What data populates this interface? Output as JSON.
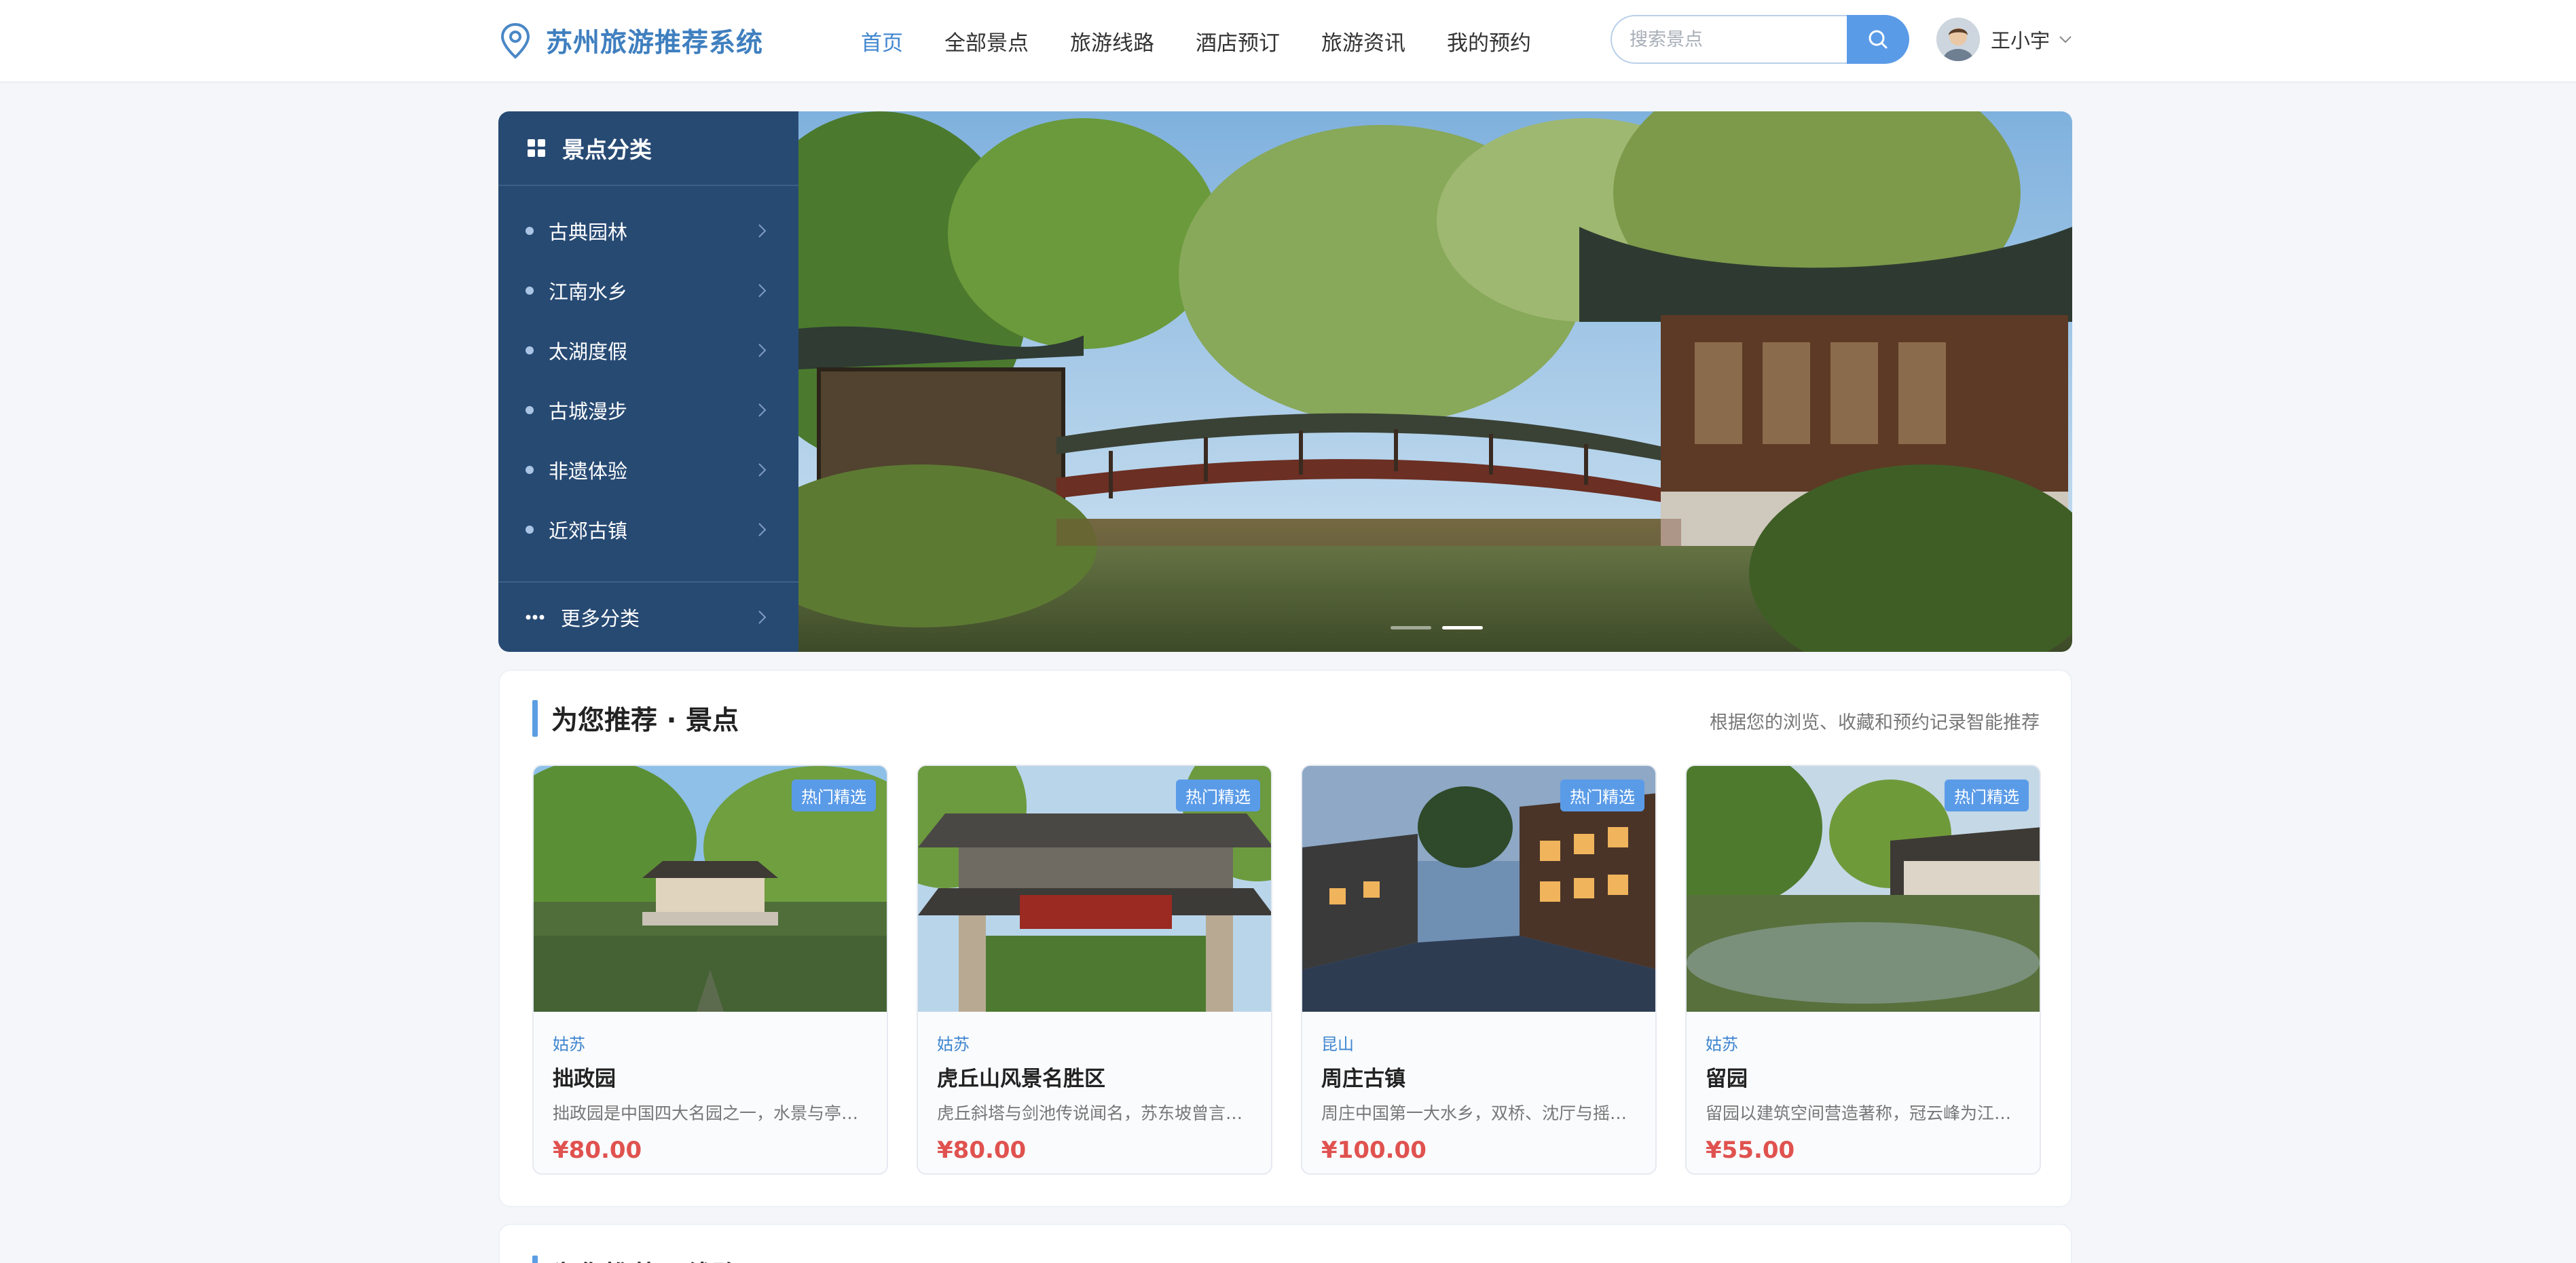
{
  "app": {
    "title": "苏州旅游推荐系统",
    "accent": "#3f7fbf",
    "brand_icon": "location-pin-icon"
  },
  "nav": {
    "items": [
      {
        "label": "首页",
        "active": true
      },
      {
        "label": "全部景点",
        "active": false
      },
      {
        "label": "旅游线路",
        "active": false
      },
      {
        "label": "酒店预订",
        "active": false
      },
      {
        "label": "旅游资讯",
        "active": false
      },
      {
        "label": "我的预约",
        "active": false
      }
    ]
  },
  "search": {
    "placeholder": "搜索景点",
    "value": "",
    "icon": "search-icon"
  },
  "user": {
    "name": "王小宇",
    "icon": "chevron-down-icon"
  },
  "categories": {
    "title": "景点分类",
    "icon": "grid-icon",
    "items": [
      {
        "label": "古典园林"
      },
      {
        "label": "江南水乡"
      },
      {
        "label": "太湖度假"
      },
      {
        "label": "古城漫步"
      },
      {
        "label": "非遗体验"
      },
      {
        "label": "近郊古镇"
      }
    ],
    "more_label": "更多分类",
    "more_icon": "more-dots-icon"
  },
  "carousel": {
    "slide_count": 2,
    "active_index": 1
  },
  "recommend": {
    "title": "为您推荐 · 景点",
    "hint": "根据您的浏览、收藏和预约记录智能推荐",
    "cards": [
      {
        "badge": "热门精选",
        "region": "姑苏",
        "name": "拙政园",
        "desc": "拙政园是中国四大名园之一，水景与亭台楼阁相映成趣",
        "price": "¥80.00"
      },
      {
        "badge": "热门精选",
        "region": "姑苏",
        "name": "虎丘山风景名胜区",
        "desc": "虎丘斜塔与剑池传说闻名，苏东坡曾言到苏州不游虎丘",
        "price": "¥80.00"
      },
      {
        "badge": "热门精选",
        "region": "昆山",
        "name": "周庄古镇",
        "desc": "周庄中国第一大水乡，双桥、沈厅与摇橹船夜景迷人",
        "price": "¥100.00"
      },
      {
        "badge": "热门精选",
        "region": "姑苏",
        "name": "留园",
        "desc": "留园以建筑空间营造著称，冠云峰为江南园林名石",
        "price": "¥55.00"
      }
    ]
  },
  "recommend2": {
    "title": "为您推荐 · 线路"
  },
  "colors": {
    "nav_active": "#3f86cf",
    "category_panel": "#274a73",
    "price": "#e0524f",
    "badge": "#5a9be8"
  }
}
